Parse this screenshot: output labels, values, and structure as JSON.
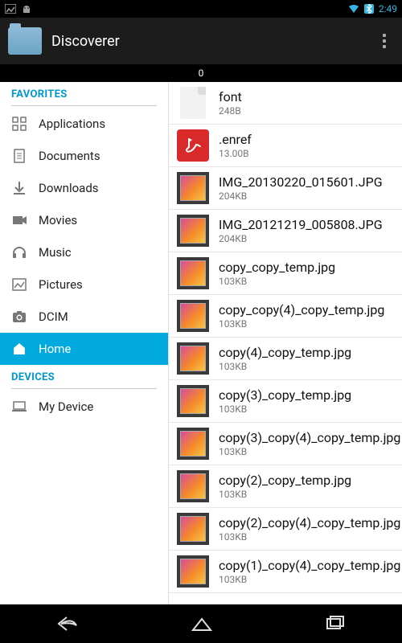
{
  "statusbar": {
    "time": "2:49",
    "bt_active": true
  },
  "header": {
    "app_title": "Discoverer"
  },
  "pathbar": {
    "items_count": "0"
  },
  "sidebar": {
    "favorites_label": "FAVORITES",
    "devices_label": "DEVICES",
    "favorites": [
      {
        "icon": "apps",
        "label": "Applications"
      },
      {
        "icon": "doc",
        "label": "Documents"
      },
      {
        "icon": "download",
        "label": "Downloads"
      },
      {
        "icon": "movie",
        "label": "Movies"
      },
      {
        "icon": "music",
        "label": "Music"
      },
      {
        "icon": "picture",
        "label": "Pictures"
      },
      {
        "icon": "camera",
        "label": "DCIM"
      },
      {
        "icon": "home",
        "label": "Home",
        "active": true
      }
    ],
    "devices": [
      {
        "icon": "laptop",
        "label": "My Device"
      }
    ]
  },
  "files": [
    {
      "thumb": "file",
      "name": "font",
      "size": "248B"
    },
    {
      "thumb": "pdf",
      "name": ".enref",
      "size": "13.00B"
    },
    {
      "thumb": "img",
      "name": "IMG_20130220_015601.JPG",
      "size": "204KB"
    },
    {
      "thumb": "img",
      "name": "IMG_20121219_005808.JPG",
      "size": "204KB"
    },
    {
      "thumb": "img",
      "name": "copy_copy_temp.jpg",
      "size": "103KB"
    },
    {
      "thumb": "img",
      "name": "copy_copy(4)_copy_temp.jpg",
      "size": "103KB"
    },
    {
      "thumb": "img",
      "name": "copy(4)_copy_temp.jpg",
      "size": "103KB"
    },
    {
      "thumb": "img",
      "name": "copy(3)_copy_temp.jpg",
      "size": "103KB"
    },
    {
      "thumb": "img",
      "name": "copy(3)_copy(4)_copy_temp.jpg",
      "size": "103KB"
    },
    {
      "thumb": "img",
      "name": "copy(2)_copy_temp.jpg",
      "size": "103KB"
    },
    {
      "thumb": "img",
      "name": "copy(2)_copy(4)_copy_temp.jpg",
      "size": "103KB"
    },
    {
      "thumb": "img",
      "name": "copy(1)_copy(4)_copy_temp.jpg",
      "size": "103KB"
    }
  ]
}
